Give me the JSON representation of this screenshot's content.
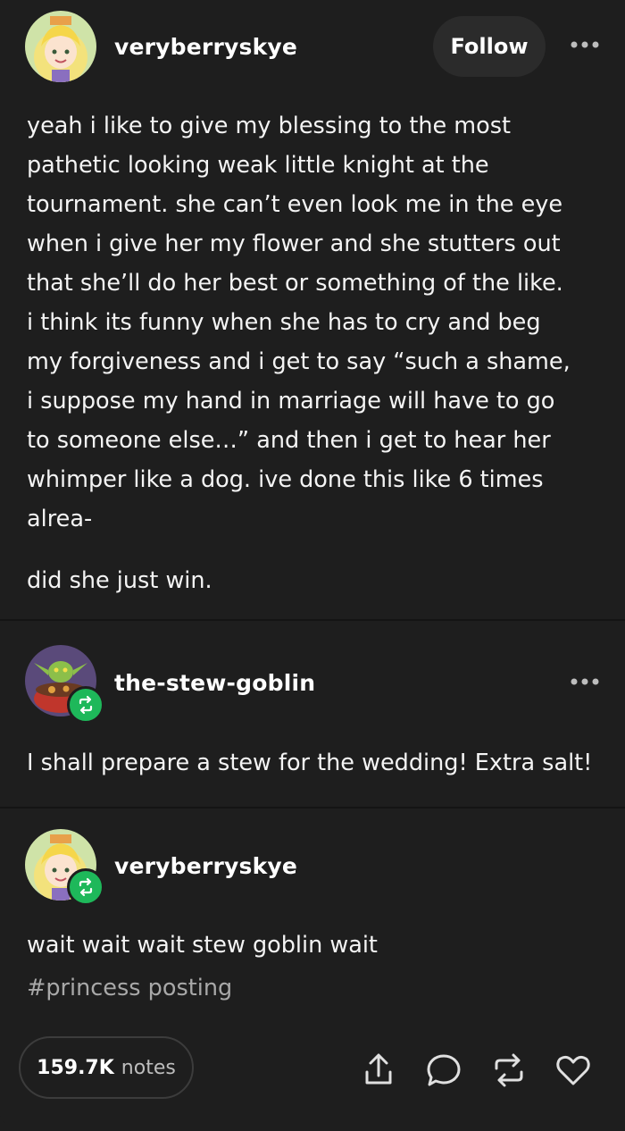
{
  "post": {
    "author": "veryberryskye",
    "follow_label": "Follow",
    "body": "yeah i like to give my blessing to the most\npathetic looking weak little knight at the\ntournament. she can’t even look me in the eye\nwhen i give her my flower and she stutters out\nthat she’ll do her best or something of the like.\ni think its funny when she has to cry and beg\nmy forgiveness and i get to say “such a shame,\ni suppose my hand in marriage will have to go\nto someone else…” and then i get to hear her\nwhimper like a dog. ive done this like 6 times\nalrea-",
    "body_end": "did she just win."
  },
  "reblogs": [
    {
      "author": "the-stew-goblin",
      "text": "I shall prepare a stew for the wedding! Extra salt!"
    },
    {
      "author": "veryberryskye",
      "text": "wait wait wait stew goblin wait"
    }
  ],
  "tags": [
    "#princess posting"
  ],
  "footer": {
    "notes_count": "159.7K",
    "notes_label": "notes",
    "icons": [
      "share-icon",
      "reply-icon",
      "reblog-icon",
      "like-icon"
    ]
  },
  "colors": {
    "background": "#1e1e1e",
    "reblog_badge": "#1eb85a",
    "follow_button": "#2b2b2b",
    "tag_text": "#a8a8a8"
  }
}
